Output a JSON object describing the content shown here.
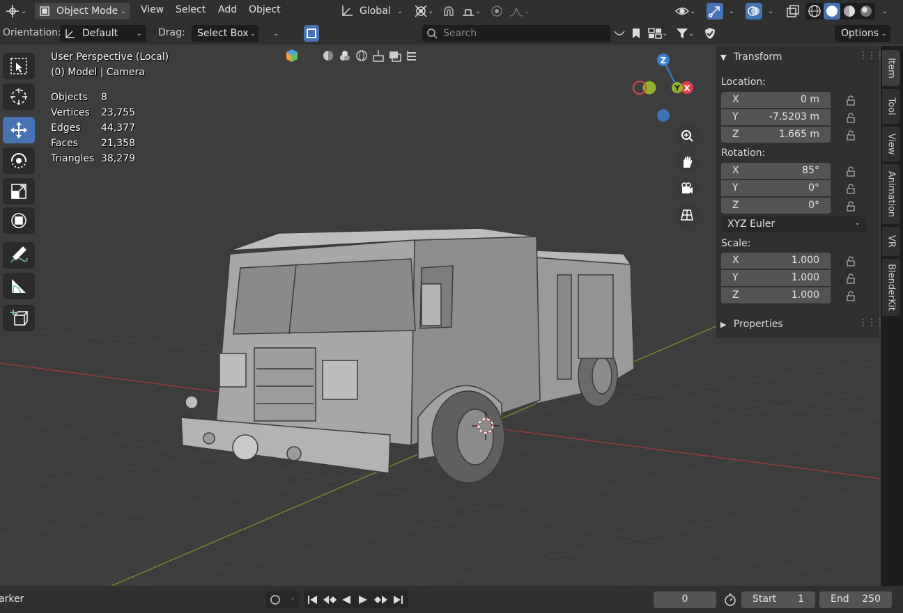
{
  "header": {
    "mode_label": "Object Mode",
    "menus": [
      "View",
      "Select",
      "Add",
      "Object"
    ],
    "transform_orientation": "Global"
  },
  "tool_header": {
    "orientation_label": "Orientation:",
    "orientation_value": "Default",
    "drag_label": "Drag:",
    "drag_value": "Select Box",
    "search_placeholder": "Search",
    "options_label": "Options"
  },
  "viewport": {
    "view_name": "User Perspective (Local)",
    "collection_info": "(0) Model | Camera",
    "stats": [
      {
        "label": "Objects",
        "value": "8"
      },
      {
        "label": "Vertices",
        "value": "23,755"
      },
      {
        "label": "Edges",
        "value": "44,377"
      },
      {
        "label": "Faces",
        "value": "21,358"
      },
      {
        "label": "Triangles",
        "value": "38,279"
      }
    ],
    "gizmo": {
      "x": "X",
      "y": "Y",
      "z": "Z"
    },
    "colors": {
      "x_axis": "#e0404f",
      "y_axis": "#8fb12c",
      "z_axis": "#3b7fd6",
      "active_tool": "#4772b3"
    }
  },
  "npanel": {
    "transform_title": "Transform",
    "location_label": "Location:",
    "location": [
      {
        "axis": "X",
        "value": "0 m"
      },
      {
        "axis": "Y",
        "value": "-7.5203 m"
      },
      {
        "axis": "Z",
        "value": "1.665 m"
      }
    ],
    "rotation_label": "Rotation:",
    "rotation": [
      {
        "axis": "X",
        "value": "85°"
      },
      {
        "axis": "Y",
        "value": "0°"
      },
      {
        "axis": "Z",
        "value": "0°"
      }
    ],
    "rotation_mode": "XYZ Euler",
    "scale_label": "Scale:",
    "scale": [
      {
        "axis": "X",
        "value": "1.000"
      },
      {
        "axis": "Y",
        "value": "1.000"
      },
      {
        "axis": "Z",
        "value": "1.000"
      }
    ],
    "properties_title": "Properties"
  },
  "tabs": [
    "Item",
    "Tool",
    "View",
    "Animation",
    "VR",
    "BlenderKit"
  ],
  "timeline": {
    "marker_label": "arker",
    "current_frame": "0",
    "start_label": "Start",
    "start_value": "1",
    "end_label": "End",
    "end_value": "250"
  }
}
